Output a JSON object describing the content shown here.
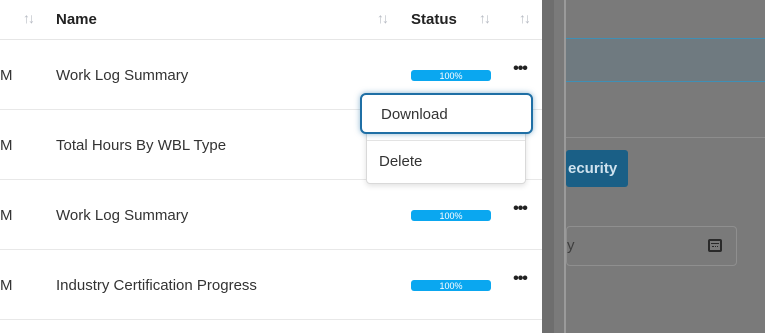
{
  "table": {
    "headers": {
      "name": "Name",
      "status": "Status"
    },
    "rows": [
      {
        "date_tail": "M",
        "name": "Work Log Summary",
        "progress_label": "100%",
        "progress_value": 100
      },
      {
        "date_tail": "M",
        "name": "Total Hours By WBL Type"
      },
      {
        "date_tail": "M",
        "name": "Work Log Summary",
        "progress_label": "100%",
        "progress_value": 100
      },
      {
        "date_tail": "M",
        "name": "Industry Certification Progress",
        "progress_label": "100%",
        "progress_value": 100
      }
    ],
    "more_glyph": "•••"
  },
  "menu": {
    "download_label": "Download",
    "delete_label": "Delete"
  },
  "overlay": {
    "button_label": "ecurity",
    "input_text": "y"
  },
  "colors": {
    "progress": "#0aa7f0",
    "focus_border": "#1f6fa5",
    "overlay_bg": "#7a7a7a",
    "overlay_button": "#1a5f86"
  },
  "icons": {
    "sort": "sort-arrows-icon",
    "more": "more-horizontal-icon",
    "calendar": "calendar-icon"
  }
}
